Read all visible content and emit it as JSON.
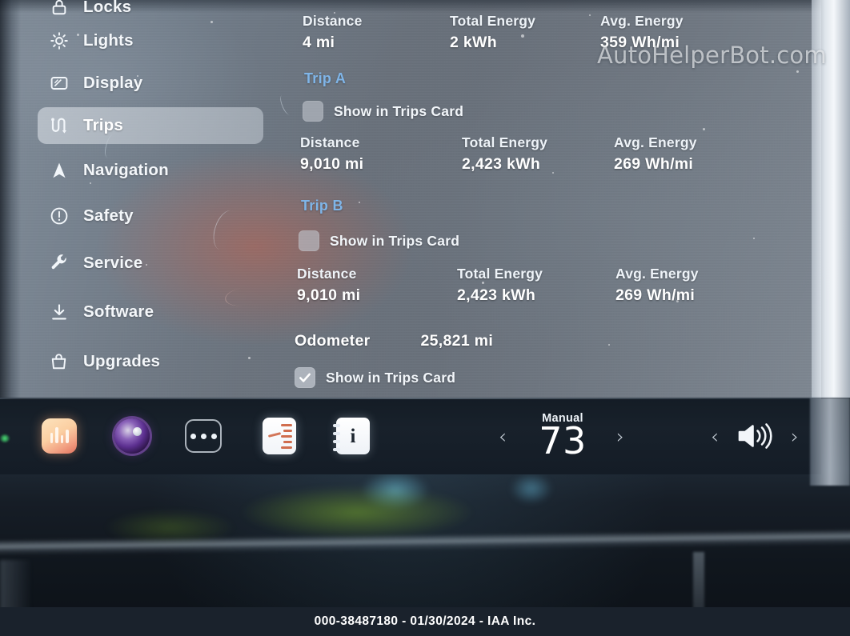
{
  "colors": {
    "accent_blue": "#7fb5e8",
    "screen_bg": "#6a727c",
    "taskbar_bg": "#18212b",
    "text_primary": "#ffffff",
    "footer_bg": "#1a222c"
  },
  "sidebar": {
    "items": [
      {
        "label": "Locks",
        "icon": "lock-icon",
        "active": false
      },
      {
        "label": "Lights",
        "icon": "sun-icon",
        "active": false
      },
      {
        "label": "Display",
        "icon": "display-icon",
        "active": false
      },
      {
        "label": "Trips",
        "icon": "trips-icon",
        "active": true
      },
      {
        "label": "Navigation",
        "icon": "navigation-icon",
        "active": false
      },
      {
        "label": "Safety",
        "icon": "warning-icon",
        "active": false
      },
      {
        "label": "Service",
        "icon": "wrench-icon",
        "active": false
      },
      {
        "label": "Software",
        "icon": "download-icon",
        "active": false
      },
      {
        "label": "Upgrades",
        "icon": "bag-icon",
        "active": false
      }
    ]
  },
  "content": {
    "field_labels": {
      "distance": "Distance",
      "total_energy": "Total Energy",
      "avg_energy": "Avg. Energy"
    },
    "checkbox_label": "Show in Trips Card",
    "current_trip": {
      "distance": "4 mi",
      "total_energy": "2 kWh",
      "avg_energy": "359 Wh/mi"
    },
    "trip_a": {
      "title": "Trip A",
      "show_in_trips_card": false,
      "distance": "9,010 mi",
      "total_energy": "2,423 kWh",
      "avg_energy": "269 Wh/mi"
    },
    "trip_b": {
      "title": "Trip B",
      "show_in_trips_card": false,
      "distance": "9,010 mi",
      "total_energy": "2,423 kWh",
      "avg_energy": "269 Wh/mi"
    },
    "odometer": {
      "label": "Odometer",
      "value": "25,821 mi",
      "show_in_trips_card": true
    },
    "watermark": "AutoHelperBot.com"
  },
  "taskbar": {
    "icons": [
      {
        "name": "media-icon"
      },
      {
        "name": "camera-icon"
      },
      {
        "name": "more-options-icon"
      },
      {
        "name": "notes-icon"
      },
      {
        "name": "info-card-icon"
      }
    ],
    "climate": {
      "mode": "Manual",
      "temperature": "73",
      "prev_label": "‹",
      "next_label": "›"
    },
    "volume": {
      "icon": "volume-icon",
      "prev_label": "‹",
      "next_label": "›"
    }
  },
  "footer": {
    "text": "000-38487180 - 01/30/2024 - IAA Inc."
  }
}
